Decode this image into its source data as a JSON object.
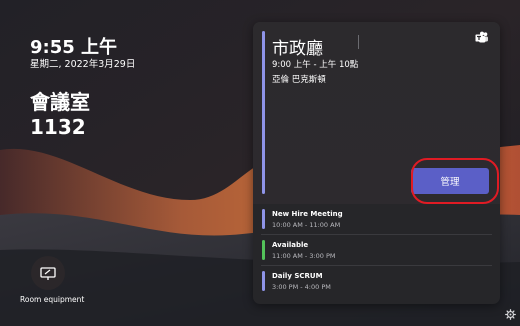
{
  "clock": {
    "time": "9:55 上午",
    "date": "星期二, 2022年3月29日"
  },
  "room": {
    "name_line1": "會議室",
    "name_line2": "1132"
  },
  "equipment": {
    "label": "Room equipment",
    "icon": "whiteboard-icon"
  },
  "current_meeting": {
    "title": "市政廳",
    "time": "9:00 上午 - 上午 10點",
    "organizer": "亞倫 巴克斯頓",
    "accent": "#8f94e8",
    "app_icon": "microsoft-teams-icon",
    "manage_label": "管理",
    "manage_color": "#5b5fc7"
  },
  "upcoming": [
    {
      "title": "New Hire Meeting",
      "time": "10:00 AM - 11:00 AM",
      "color": "#8f94e8"
    },
    {
      "title": "Available",
      "time": "11:00 AM - 3:00 PM",
      "color": "#53c35a"
    },
    {
      "title": "Daily SCRUM",
      "time": "3:00 PM - 4:00 PM",
      "color": "#8f94e8"
    }
  ],
  "annotation_color": "#e01b24",
  "settings_icon": "gear-icon"
}
